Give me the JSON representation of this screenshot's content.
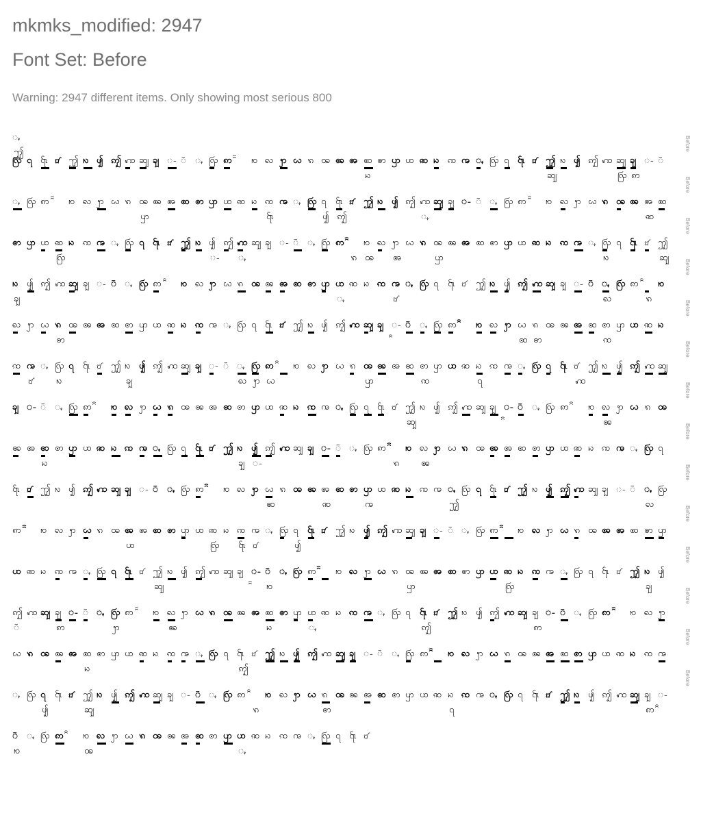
{
  "header": {
    "title": "mkmks_modified: 2947",
    "subtitle": "Font Set: Before",
    "warning": "Warning: 2947 different items. Only showing most serious 800"
  },
  "row_label": "Before",
  "row_count": 15,
  "glyph_tokens": [
    "ꩻ",
    "ꩺ",
    "꩹",
    "꩷",
    "꩸",
    "ꩶ",
    "ꩳ",
    "ꩴ",
    "ꩵ",
    "ꩲ",
    "ꩿ",
    "ꩾ",
    "ꩽ",
    "ꩼ",
    "ꩻ",
    "ꩺ",
    "ꩱ",
    "ꩰ",
    "ꩯ",
    "ꩮ",
    "ꩭ",
    "ꩬ",
    "ꩫ",
    "ꩪ",
    "ꩩ",
    "ꩨ",
    "ꩧ",
    "ꩦ",
    "ꩥ",
    "ꩤ",
    "ꩣ",
    "ꩢ",
    "ꩡ",
    "ꩠ"
  ]
}
